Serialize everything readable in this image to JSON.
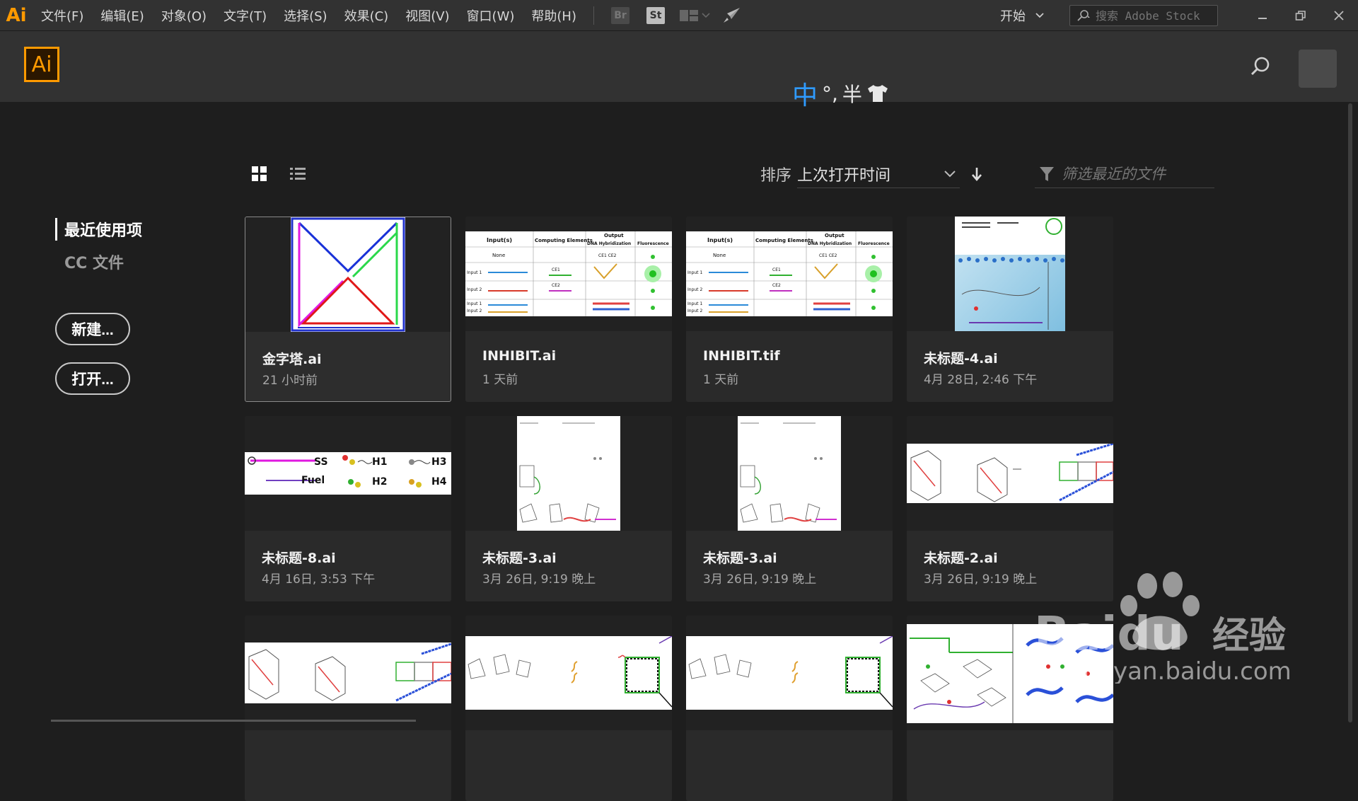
{
  "menubar": {
    "app_abbr": "Ai",
    "items": [
      "文件(F)",
      "编辑(E)",
      "对象(O)",
      "文字(T)",
      "选择(S)",
      "效果(C)",
      "视图(V)",
      "窗口(W)",
      "帮助(H)"
    ],
    "bridge": "Br",
    "stock": "St",
    "workspace": "开始",
    "stock_search_placeholder": "搜索 Adobe Stock"
  },
  "header": {
    "logo_text": "Ai",
    "ime": {
      "lang": "中",
      "punct": "°,",
      "width": "半"
    }
  },
  "sidebar": {
    "nav": [
      "最近使用项",
      "CC 文件"
    ],
    "new_label": "新建...",
    "open_label": "打开..."
  },
  "toolbar": {
    "sort_label": "排序",
    "sort_value": "上次打开时间",
    "filter_placeholder": "筛选最近的文件"
  },
  "files": [
    {
      "name": "金字塔.ai",
      "time": "21 小时前",
      "selected": true,
      "thumb": "pyramid"
    },
    {
      "name": "INHIBIT.ai",
      "time": "1 天前",
      "thumb": "table"
    },
    {
      "name": "INHIBIT.tif",
      "time": "1 天前",
      "thumb": "table"
    },
    {
      "name": "未标题-4.ai",
      "time": "4月 28日, 2:46 下午",
      "thumb": "membrane"
    },
    {
      "name": "未标题-8.ai",
      "time": "4月 16日, 3:53 下午",
      "thumb": "hairpin"
    },
    {
      "name": "未标题-3.ai",
      "time": "3月 26日, 9:19 晚上",
      "thumb": "portrait"
    },
    {
      "name": "未标题-3.ai",
      "time": "3月 26日, 9:19 晚上",
      "thumb": "portrait"
    },
    {
      "name": "未标题-2.ai",
      "time": "3月 26日, 9:19 晚上",
      "thumb": "prism"
    },
    {
      "name": "",
      "time": "",
      "thumb": "prism"
    },
    {
      "name": "",
      "time": "",
      "thumb": "wide"
    },
    {
      "name": "",
      "time": "",
      "thumb": "wide"
    },
    {
      "name": "",
      "time": "",
      "thumb": "dense"
    }
  ],
  "table_thumb": {
    "headers": [
      "Input(s)",
      "Computing Elements",
      "Output",
      "DNA Hybridization",
      "Fluorescence"
    ],
    "rows": [
      "None",
      "Input 1",
      "Input 2",
      "Input 1",
      "Input 2"
    ],
    "ce": [
      "CE1",
      "CE2",
      "CE1 CE2",
      "CE1",
      "CE2",
      "Input 2",
      "CE1",
      "CE2"
    ]
  },
  "hairpin_thumb": {
    "labels": [
      "SS",
      "Fuel",
      "H1",
      "H2",
      "H3",
      "H4"
    ]
  },
  "colors": {
    "accent": "#ff9a00",
    "ime_blue": "#2f9bff"
  },
  "watermark": {
    "brand": "Baidu",
    "suffix": "经验",
    "url": "jingyan.baidu.com"
  }
}
